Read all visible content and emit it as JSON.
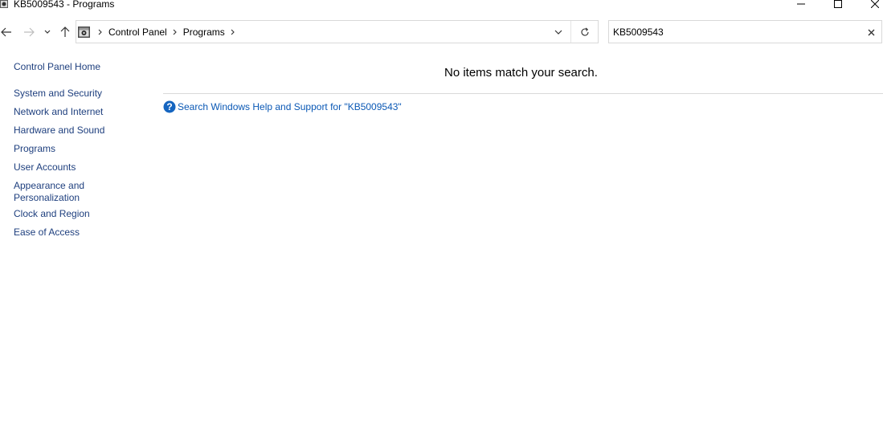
{
  "window": {
    "title": "KB5009543 - Programs"
  },
  "address_bar": {
    "crumbs": [
      "Control Panel",
      "Programs"
    ]
  },
  "search": {
    "value": "KB5009543"
  },
  "sidebar": {
    "items": [
      {
        "label": "Control Panel Home"
      },
      {
        "label": "System and Security"
      },
      {
        "label": "Network and Internet"
      },
      {
        "label": "Hardware and Sound"
      },
      {
        "label": "Programs"
      },
      {
        "label": "User Accounts"
      },
      {
        "label": "Appearance and"
      },
      {
        "label": "Personalization"
      },
      {
        "label": "Clock and Region"
      },
      {
        "label": "Ease of Access"
      }
    ]
  },
  "results": {
    "empty_message": "No items match your search.",
    "help_link": "Search Windows Help and Support for \"KB5009543\""
  },
  "colors": {
    "link": "#1e3f7e",
    "help_link": "#0a58b5",
    "help_icon": "#1565c0",
    "border": "#d9d9d9"
  },
  "icons": {
    "app": "control-panel-icon",
    "help": "help-question-icon"
  }
}
